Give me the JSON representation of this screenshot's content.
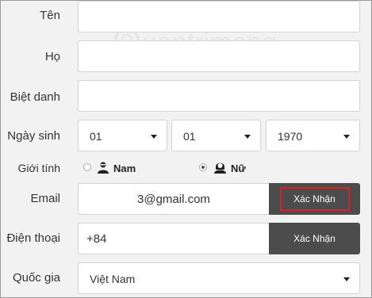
{
  "form": {
    "first_name_label": "Tên",
    "last_name_label": "Họ",
    "nickname_label": "Biệt danh",
    "birthday_label": "Ngày sinh",
    "gender_label": "Giới tính",
    "email_label": "Email",
    "phone_label": "Điện thoại",
    "country_label": "Quốc gia"
  },
  "birthday": {
    "day": "01",
    "month": "01",
    "year": "1970"
  },
  "gender": {
    "male_label": "Nam",
    "female_label": "Nữ",
    "selected": "female"
  },
  "email": {
    "value": "3@gmail.com",
    "confirm_label": "Xác Nhận"
  },
  "phone": {
    "value": "+84",
    "confirm_label": "Xác Nhận"
  },
  "country": {
    "value": "Việt Nam"
  },
  "watermark": {
    "text": "uantrimang"
  },
  "colors": {
    "highlight": "#e02020",
    "button_bg": "#4c4c4c"
  }
}
